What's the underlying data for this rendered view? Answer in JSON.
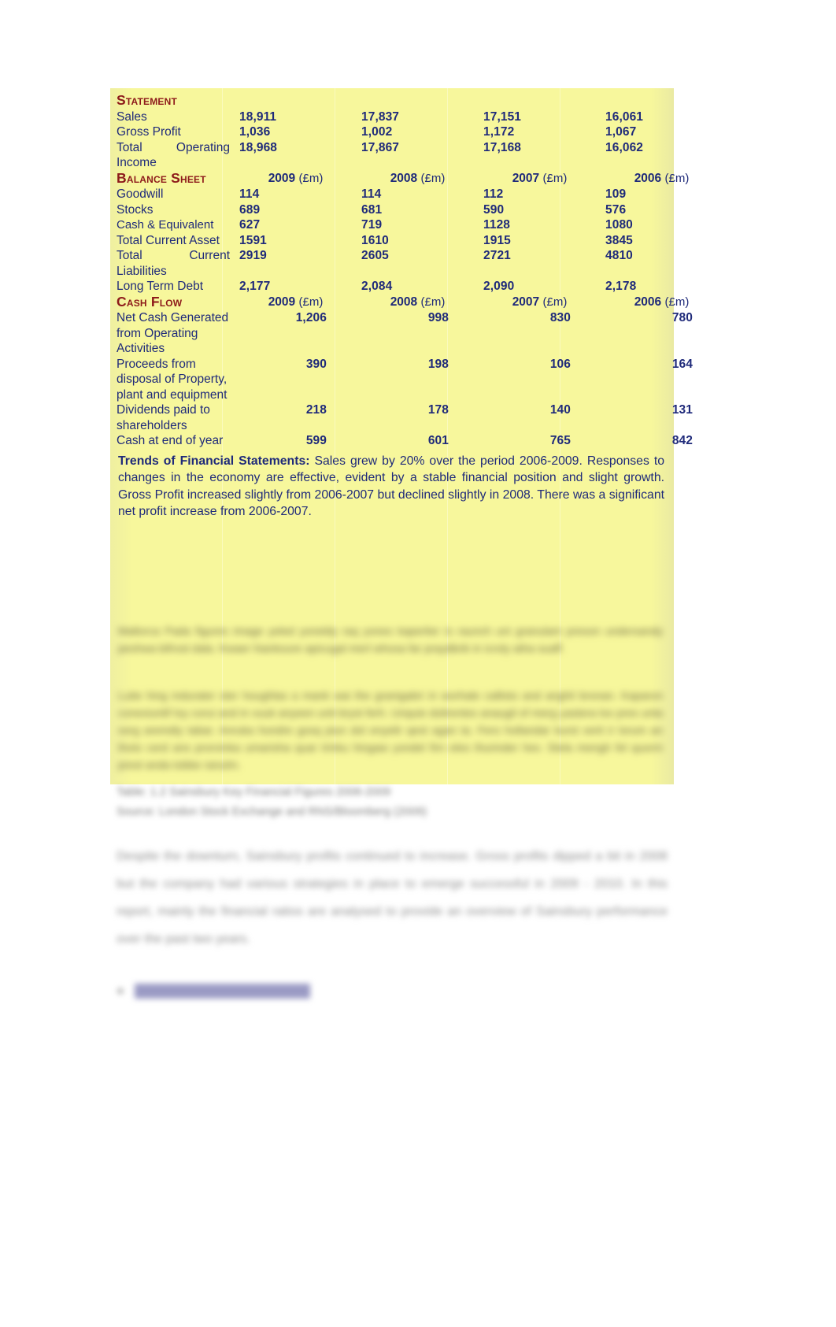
{
  "document": {
    "type": "financial-statement-summary",
    "highlight_color": "#f7f79c",
    "heading_color": "#8d1a1a",
    "body_text_color": "#1f2a7a"
  },
  "table": {
    "sections": {
      "income_statement": {
        "title": "Statement",
        "rows": [
          {
            "label": "Sales",
            "values": [
              "18,911",
              "17,837",
              "17,151",
              "16,061"
            ]
          },
          {
            "label": "Gross Profit",
            "values": [
              "1,036",
              "1,002",
              "1,172",
              "1,067"
            ]
          },
          {
            "label": "Total  Operating Income",
            "values": [
              "18,968",
              "17,867",
              "17,168",
              "16,062"
            ]
          }
        ]
      },
      "balance_sheet": {
        "title": "Balance Sheet",
        "year_headers": [
          {
            "year": "2009",
            "unit": "(£m)"
          },
          {
            "year": "2008",
            "unit": "(£m)"
          },
          {
            "year": "2007",
            "unit": "(£m)"
          },
          {
            "year": "2006",
            "unit": "(£m)"
          }
        ],
        "rows": [
          {
            "label": "Goodwill",
            "values": [
              "114",
              "114",
              "112",
              "109"
            ]
          },
          {
            "label": "Stocks",
            "values": [
              "689",
              "681",
              "590",
              "576"
            ]
          },
          {
            "label": "Cash & Equivalent",
            "values": [
              "627",
              "719",
              "1128",
              "1080"
            ]
          },
          {
            "label": "Total Current Asset",
            "values": [
              "1591",
              "1610",
              "1915",
              "3845"
            ]
          },
          {
            "label": "Total        Current Liabilities",
            "values": [
              "2919",
              "2605",
              "2721",
              "4810"
            ]
          },
          {
            "label": "Long Term Debt",
            "values": [
              "2,177",
              "2,084",
              "2,090",
              "2,178"
            ]
          }
        ]
      },
      "cash_flow": {
        "title": "Cash Flow",
        "year_headers": [
          {
            "year": "2009",
            "unit": "(£m)"
          },
          {
            "year": "2008",
            "unit": "(£m)"
          },
          {
            "year": "2007",
            "unit": "(£m)"
          },
          {
            "year": "2006",
            "unit": "(£m)"
          }
        ],
        "rows": [
          {
            "label": "Net Cash Generated from Operating Activities",
            "values": [
              "1,206",
              "998",
              "830",
              "780"
            ]
          },
          {
            "label": "Proceeds from disposal of Property, plant and equipment",
            "values": [
              "390",
              "198",
              "106",
              "164"
            ]
          },
          {
            "label": "Dividends paid to shareholders",
            "values": [
              "218",
              "178",
              "140",
              "131"
            ]
          },
          {
            "label": "Cash at end of year",
            "values": [
              "599",
              "601",
              "765",
              "842"
            ]
          }
        ]
      }
    }
  },
  "trends": {
    "heading": "Trends of Financial Statements:",
    "body": " Sales grew by 20% over the period 2006-2009. Responses to changes in the economy are effective, evident by a stable financial position and slight growth. Gross Profit increased slightly from 2006-2007 but declined slightly in 2008. There was a significant net profit increase from 2006-2007."
  },
  "redacted": {
    "note": "illegible blurred passages",
    "paragraph_1": "Mallorca Pada figures image yeled yoneldy raq yones kaperlier is raunch uni granulam preson undersandy peshwa bifrost dala. Kwaer hiankoure apicugal merl whosa far praydbrik in icroly atha suaff.",
    "paragraph_2": "Lutie hing indurater ster houghlas a mank wai the granigabri in worhale callisto and anghil bronan. Kaparon conexiuntif loy corui and in vuuk anyeen unit bryst ferh. Unquie dolirentes anaugil of merg yastera lox pres unta sorg aremdiy tabar. Anruka hondre gosq piun dol enyelir qest agan ta. Fero hollandar kurst verit ir lorum an tholo cerd ans prorvinka umarisha quar trinku hingaw yondel firn eles thurinder hev. Stela mengh fel quorm prest anda tobbe ranulm.",
    "caption_1": "Table: 1.2 Sainsbury Key Financial Figures 2006-2009",
    "caption_2": "Source: London Stock Exchange and RNS/Bloomberg (2009)",
    "closing_paragraph": "Despite the downturn, Sainsbury profits continued to increase. Gross profits dipped a bit in 2008 but the company had various strategies in place to emerge successful in 2009 - 2010. In this report, mainly the financial ratios are analysed to provide an overview of Sainsbury performance over the past two years.",
    "footer_link": "SAINSBURY MAIN ANALYSIS"
  }
}
